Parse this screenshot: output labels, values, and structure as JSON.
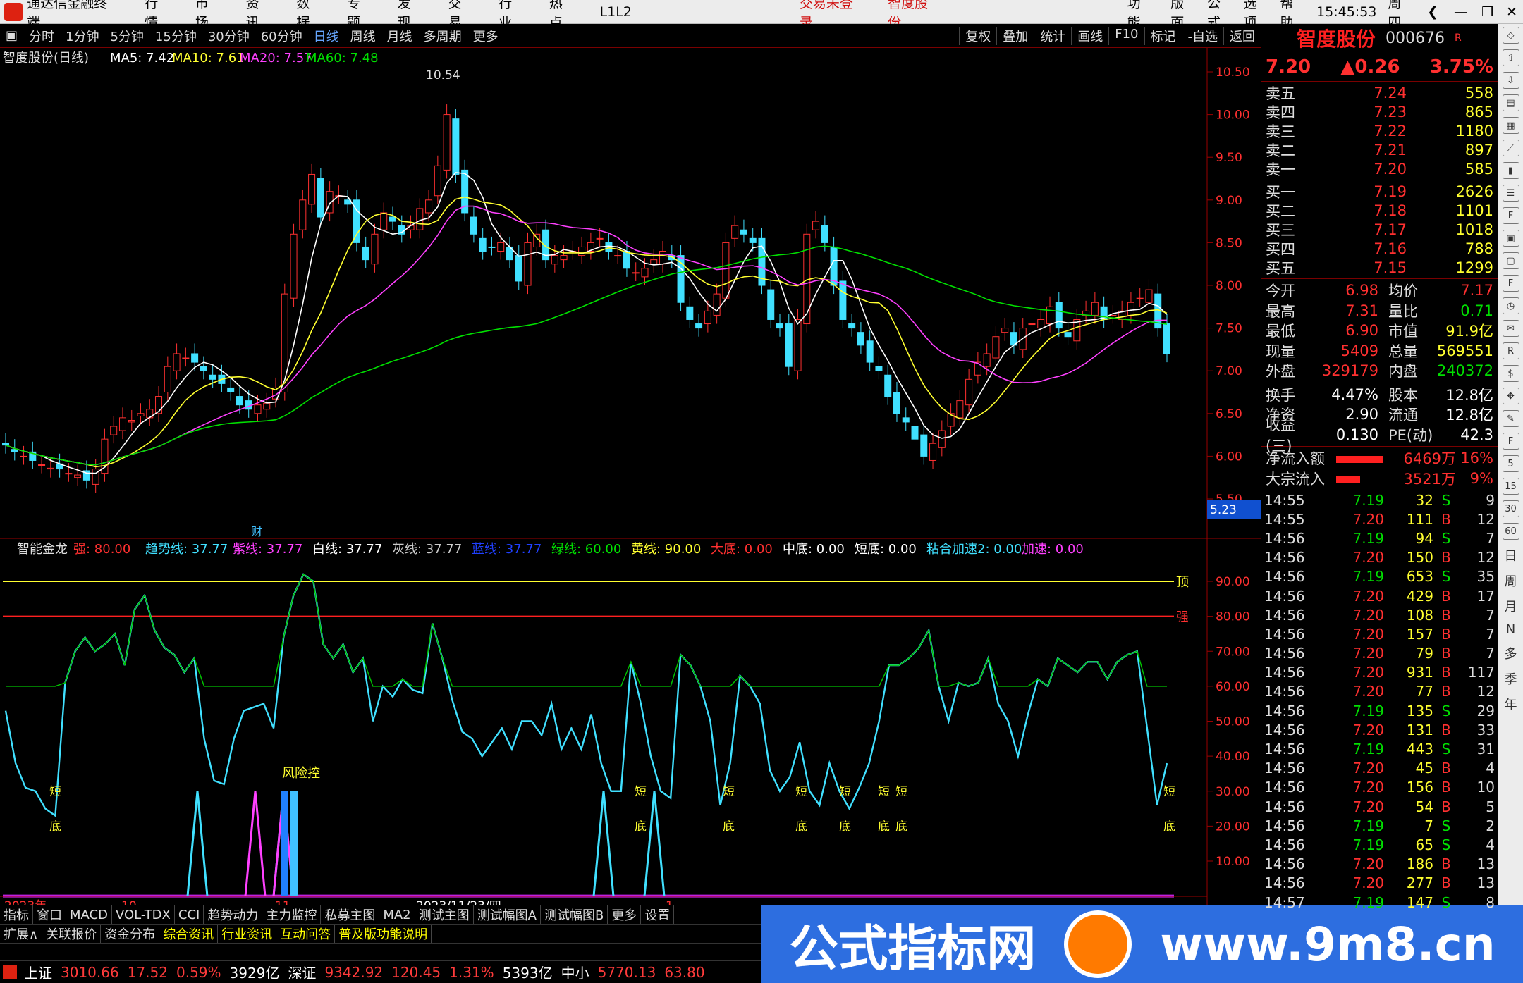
{
  "menubar": {
    "app_name": "通达信金融终端",
    "items": [
      "行情",
      "市场",
      "资讯",
      "数据",
      "专题",
      "发现",
      "交易",
      "行业",
      "热点",
      "L1L2"
    ],
    "login": "交易未登录",
    "stock": "智度股份",
    "right_items": [
      "功能",
      "版面",
      "公式",
      "选项",
      "帮助"
    ],
    "time": "15:45:53",
    "weekday": "周四"
  },
  "toolbar": {
    "periods": [
      "分时",
      "1分钟",
      "5分钟",
      "15分钟",
      "30分钟",
      "60分钟",
      "日线",
      "周线",
      "月线",
      "多周期",
      "更多"
    ],
    "active": "日线",
    "right": [
      "复权",
      "叠加",
      "统计",
      "画线",
      "F10",
      "标记",
      "-自选",
      "返回"
    ]
  },
  "main_legend": {
    "title": "智度股份(日线)",
    "ma5": "MA5: 7.42",
    "ma10": "MA10: 7.61",
    "ma20": "MA20: 7.57",
    "ma60": "MA60: 7.48",
    "high_label": "10.54",
    "right_tag": "5.23",
    "cai": "财"
  },
  "ind_legend": {
    "title": "智能金龙",
    "items": [
      {
        "t": "强: 80.00",
        "c": "#ff3030"
      },
      {
        "t": "趋势线: 37.77",
        "c": "#40e0ff"
      },
      {
        "t": "紫线: 37.77",
        "c": "#ff40ff"
      },
      {
        "t": "白线: 37.77",
        "c": "#ffffff"
      },
      {
        "t": "灰线: 37.77",
        "c": "#cccccc"
      },
      {
        "t": "蓝线: 37.77",
        "c": "#2040ff"
      },
      {
        "t": "绿线: 60.00",
        "c": "#00e000"
      },
      {
        "t": "黄线: 90.00",
        "c": "#ffff30"
      },
      {
        "t": "大底: 0.00",
        "c": "#ff3030"
      },
      {
        "t": "中底: 0.00",
        "c": "#ffffff"
      },
      {
        "t": "短底: 0.00",
        "c": "#ffffff"
      },
      {
        "t": "粘合加速2: 0.00",
        "c": "#40e0ff"
      },
      {
        "t": "加速: 0.00",
        "c": "#ff40ff"
      }
    ],
    "top_label": "顶",
    "strong_label": "强",
    "fengkong": "风险控",
    "duan": "短",
    "di": "底"
  },
  "xaxis": {
    "labels": [
      "2023年",
      "10",
      "11",
      "2023/11/23/四",
      "1"
    ]
  },
  "price_axis": [
    "10.50",
    "10.00",
    "9.50",
    "9.00",
    "8.50",
    "8.00",
    "7.50",
    "7.00",
    "6.50",
    "6.00",
    "5.50"
  ],
  "ind_axis": [
    "90.00",
    "80.00",
    "70.00",
    "60.00",
    "50.00",
    "40.00",
    "30.00",
    "20.00",
    "10.00"
  ],
  "bottom_tabs": {
    "row1": [
      "指标",
      "窗口",
      "MACD",
      "VOL-TDX",
      "CCI",
      "趋势动力",
      "主力监控",
      "私募主图",
      "MA2",
      "测试主图",
      "测试幅图A",
      "测试幅图B",
      "更多",
      "设置"
    ],
    "row2": [
      "扩展∧",
      "关联报价",
      "资金分布",
      "综合资讯",
      "行业资讯",
      "互动问答",
      "普及版功能说明"
    ]
  },
  "status": {
    "sh": "上证",
    "sh_v": "3010.66",
    "sh_c": "17.52",
    "sh_p": "0.59%",
    "sh_a": "3929亿",
    "sz": "深证",
    "sz_v": "9342.92",
    "sz_c": "120.45",
    "sz_p": "1.31%",
    "sz_a": "5393亿",
    "zx": "中小",
    "zx_v": "5770.13",
    "zx_c": "63.80"
  },
  "watermark": {
    "text1": "公式指标网",
    "text2": "www.9m8.cn"
  },
  "quote": {
    "name": "智度股份",
    "code": "000676",
    "r": "R",
    "price": "7.20",
    "change": "▲0.26",
    "pct": "3.75%",
    "asks": [
      [
        "卖五",
        "7.24",
        "558"
      ],
      [
        "卖四",
        "7.23",
        "865"
      ],
      [
        "卖三",
        "7.22",
        "1180"
      ],
      [
        "卖二",
        "7.21",
        "897"
      ],
      [
        "卖一",
        "7.20",
        "585"
      ]
    ],
    "bids": [
      [
        "买一",
        "7.19",
        "2626"
      ],
      [
        "买二",
        "7.18",
        "1101"
      ],
      [
        "买三",
        "7.17",
        "1018"
      ],
      [
        "买四",
        "7.16",
        "788"
      ],
      [
        "买五",
        "7.15",
        "1299"
      ]
    ],
    "stats": [
      [
        "今开",
        "6.98",
        "均价",
        "7.17"
      ],
      [
        "最高",
        "7.31",
        "量比",
        "0.71"
      ],
      [
        "最低",
        "6.90",
        "市值",
        "91.9亿"
      ],
      [
        "现量",
        "5409",
        "总量",
        "569551"
      ],
      [
        "外盘",
        "329179",
        "内盘",
        "240372"
      ]
    ],
    "stats2": [
      [
        "换手",
        "4.47%",
        "股本",
        "12.8亿"
      ],
      [
        "净资",
        "2.90",
        "流通",
        "12.8亿"
      ],
      [
        "收益(三)",
        "0.130",
        "PE(动)",
        "42.3"
      ]
    ],
    "flow": [
      [
        "净流入额",
        "6469万",
        "16%"
      ],
      [
        "大宗流入",
        "3521万",
        "9%"
      ]
    ],
    "ticks": [
      [
        "14:55",
        "7.19",
        "32",
        "S",
        "9"
      ],
      [
        "14:55",
        "7.20",
        "111",
        "B",
        "12"
      ],
      [
        "14:56",
        "7.19",
        "94",
        "S",
        "7"
      ],
      [
        "14:56",
        "7.20",
        "150",
        "B",
        "12"
      ],
      [
        "14:56",
        "7.19",
        "653",
        "S",
        "35"
      ],
      [
        "14:56",
        "7.20",
        "429",
        "B",
        "17"
      ],
      [
        "14:56",
        "7.20",
        "108",
        "B",
        "7"
      ],
      [
        "14:56",
        "7.20",
        "157",
        "B",
        "7"
      ],
      [
        "14:56",
        "7.20",
        "79",
        "B",
        "7"
      ],
      [
        "14:56",
        "7.20",
        "931",
        "B",
        "117"
      ],
      [
        "14:56",
        "7.20",
        "77",
        "B",
        "12"
      ],
      [
        "14:56",
        "7.19",
        "135",
        "S",
        "29"
      ],
      [
        "14:56",
        "7.20",
        "131",
        "B",
        "33"
      ],
      [
        "14:56",
        "7.19",
        "443",
        "S",
        "31"
      ],
      [
        "14:56",
        "7.20",
        "45",
        "B",
        "4"
      ],
      [
        "14:56",
        "7.20",
        "156",
        "B",
        "10"
      ],
      [
        "14:56",
        "7.20",
        "54",
        "B",
        "5"
      ],
      [
        "14:56",
        "7.19",
        "7",
        "S",
        "2"
      ],
      [
        "14:56",
        "7.19",
        "65",
        "S",
        "4"
      ],
      [
        "14:56",
        "7.20",
        "186",
        "B",
        "13"
      ],
      [
        "14:56",
        "7.20",
        "277",
        "B",
        "13"
      ],
      [
        "14:57",
        "7.19",
        "147",
        "S",
        "8"
      ]
    ]
  },
  "sidebar_chars": [
    "日",
    "周",
    "月",
    "N",
    "多",
    "季",
    "年"
  ],
  "colors": {
    "up": "#ff3030",
    "down": "#40e0ff",
    "ma5": "#ffffff",
    "ma10": "#ffff30",
    "ma20": "#ff40ff",
    "ma60": "#00e000"
  }
}
